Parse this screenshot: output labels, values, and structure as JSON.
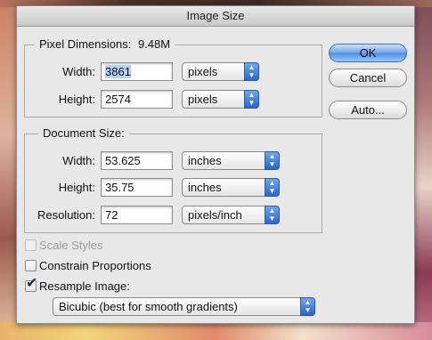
{
  "dialog": {
    "title": "Image Size"
  },
  "pixel_dimensions": {
    "legend": "Pixel Dimensions:",
    "size": "9.48M",
    "width": {
      "label": "Width:",
      "value": "3861",
      "unit": "pixels"
    },
    "height": {
      "label": "Height:",
      "value": "2574",
      "unit": "pixels"
    }
  },
  "document_size": {
    "legend": "Document Size:",
    "width": {
      "label": "Width:",
      "value": "53.625",
      "unit": "inches"
    },
    "height": {
      "label": "Height:",
      "value": "35.75",
      "unit": "inches"
    },
    "resolution": {
      "label": "Resolution:",
      "value": "72",
      "unit": "pixels/inch"
    }
  },
  "options": {
    "scale_styles": {
      "label": "Scale Styles",
      "checked": false,
      "enabled": false
    },
    "constrain_proportions": {
      "label": "Constrain Proportions",
      "checked": false,
      "enabled": true
    },
    "resample_image": {
      "label": "Resample Image:",
      "checked": true,
      "enabled": true
    },
    "resample_method": "Bicubic (best for smooth gradients)"
  },
  "buttons": {
    "ok": "OK",
    "cancel": "Cancel",
    "auto": "Auto..."
  },
  "icons": {
    "popup_arrows": "up-down-arrows-icon",
    "checkmark": "checkmark-icon"
  },
  "colors": {
    "default_button": "#4f8ee4",
    "popup_arrow": "#2a66cc",
    "selection": "#b5d1f5"
  }
}
